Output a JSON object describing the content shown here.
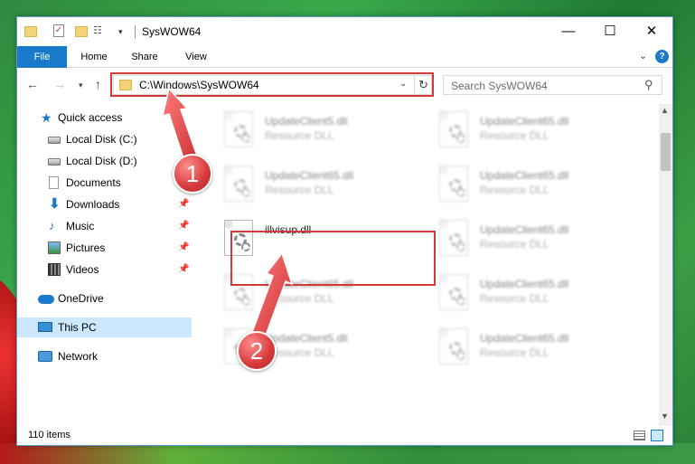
{
  "window": {
    "title": "SysWOW64"
  },
  "quick_access_toolbar": {
    "icons": [
      "folder-icon",
      "properties-check-icon",
      "new-folder-icon",
      "properties-icon",
      "customize-dropdown-icon"
    ]
  },
  "title_buttons": {
    "minimize": "—",
    "maximize": "☐",
    "close": "✕"
  },
  "ribbon": {
    "tabs": [
      {
        "label": "File",
        "active": true
      },
      {
        "label": "Home"
      },
      {
        "label": "Share"
      },
      {
        "label": "View"
      }
    ],
    "help_label": "?",
    "expand_glyph": "⌄"
  },
  "navigation": {
    "back_glyph": "←",
    "forward_glyph": "→",
    "recent_glyph": "▾",
    "up_glyph": "↑"
  },
  "address": {
    "path": "C:\\Windows\\SysWOW64",
    "dropdown_glyph": "⌄",
    "refresh_glyph": "↻"
  },
  "search": {
    "placeholder": "Search SysWOW64",
    "icon_glyph": "⚲"
  },
  "sidebar": {
    "items": [
      {
        "label": "Quick access",
        "icon": "star-icon"
      },
      {
        "label": "Local Disk (C:)",
        "icon": "drive-icon"
      },
      {
        "label": "Local Disk (D:)",
        "icon": "drive-icon"
      },
      {
        "label": "Documents",
        "icon": "documents-icon",
        "pinned": true
      },
      {
        "label": "Downloads",
        "icon": "downloads-icon",
        "pinned": true
      },
      {
        "label": "Music",
        "icon": "music-icon",
        "pinned": true
      },
      {
        "label": "Pictures",
        "icon": "pictures-icon",
        "pinned": true
      },
      {
        "label": "Videos",
        "icon": "videos-icon",
        "pinned": true
      },
      {
        "label": "OneDrive",
        "icon": "onedrive-icon"
      },
      {
        "label": "This PC",
        "icon": "this-pc-icon",
        "selected": true
      },
      {
        "label": "Network",
        "icon": "network-icon"
      }
    ],
    "pin_glyph": "📌"
  },
  "files": [
    {
      "name": "UpdateClient5.dll",
      "type": "Resource DLL",
      "blurred": true
    },
    {
      "name": "UpdateClient65.dll",
      "type": "Resource DLL",
      "blurred": true
    },
    {
      "name": "UpdateClient65.dll",
      "type": "Resource DLL",
      "blurred": true
    },
    {
      "name": "UpdateClient65.dll",
      "type": "Resource DLL",
      "blurred": true
    },
    {
      "name": "illvisup.dll",
      "type": "",
      "blurred": false,
      "highlighted": true
    },
    {
      "name": "UpdateClient65.dll",
      "type": "Resource DLL",
      "blurred": true
    },
    {
      "name": "UpdateClient65.dll",
      "type": "Resource DLL",
      "blurred": true
    },
    {
      "name": "UpdateClient65.dll",
      "type": "Resource DLL",
      "blurred": true
    },
    {
      "name": "UpdateClient5.dll",
      "type": "Resource DLL",
      "blurred": true
    },
    {
      "name": "UpdateClient65.dll",
      "type": "Resource DLL",
      "blurred": true
    }
  ],
  "scrollbar": {
    "up_glyph": "▲",
    "down_glyph": "▼"
  },
  "status": {
    "item_count": "110 items"
  },
  "annotations": {
    "badge_1": "1",
    "badge_2": "2",
    "color": "#d23a3a"
  }
}
